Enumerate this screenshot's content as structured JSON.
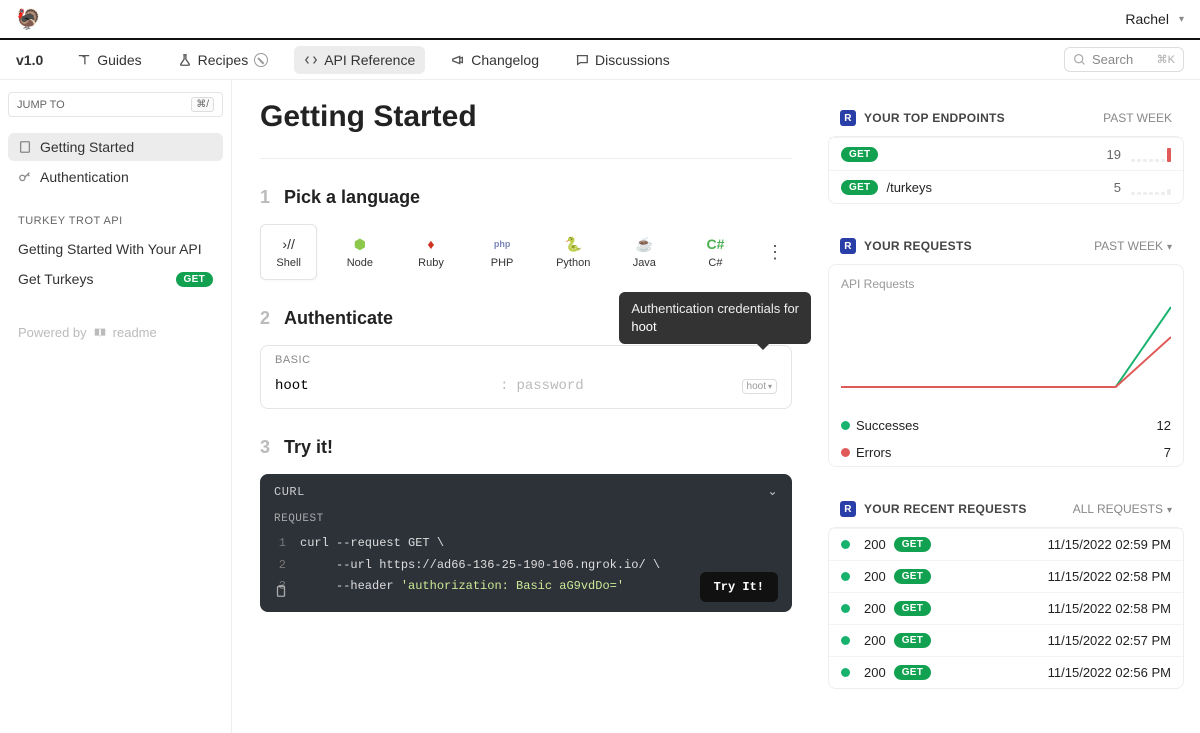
{
  "header": {
    "user_name": "Rachel"
  },
  "nav": {
    "version": "v1.0",
    "guides": "Guides",
    "recipes": "Recipes",
    "api_reference": "API Reference",
    "changelog": "Changelog",
    "discussions": "Discussions",
    "search_placeholder": "Search",
    "search_kbd": "⌘K"
  },
  "sidebar": {
    "jump_to": "JUMP TO",
    "jump_kbd": "⌘/",
    "links": [
      {
        "label": "Getting Started"
      },
      {
        "label": "Authentication"
      }
    ],
    "section_title": "TURKEY TROT API",
    "api_links": [
      {
        "label": "Getting Started With Your API"
      },
      {
        "label": "Get Turkeys",
        "method": "GET"
      }
    ],
    "powered": "Powered by",
    "powered_brand": "readme"
  },
  "content": {
    "title": "Getting Started",
    "step1_label": "Pick a language",
    "step2_label": "Authenticate",
    "step3_label": "Try it!",
    "languages": [
      "Shell",
      "Node",
      "Ruby",
      "PHP",
      "Python",
      "Java",
      "C#"
    ],
    "auth": {
      "type_label": "BASIC",
      "username_value": "hoot",
      "separator": ":",
      "password_placeholder": "password",
      "hint_text": "hoot",
      "tooltip_line1": "Authentication credentials for",
      "tooltip_line2": "hoot"
    },
    "code": {
      "title": "CURL",
      "request_label": "REQUEST",
      "lines": [
        {
          "n": "1",
          "t": "curl --request GET \\"
        },
        {
          "n": "2",
          "t": "     --url https://ad66-136-25-190-106.ngrok.io/ \\"
        },
        {
          "n": "3",
          "t": "     --header 'authorization: Basic aG9vdDo='"
        }
      ],
      "tryit": "Try It!"
    }
  },
  "right": {
    "top_endpoints": {
      "title": "YOUR TOP ENDPOINTS",
      "range": "PAST WEEK",
      "rows": [
        {
          "method": "GET",
          "path": "",
          "count": "19"
        },
        {
          "method": "GET",
          "path": "/turkeys",
          "count": "5"
        }
      ]
    },
    "requests": {
      "title": "YOUR REQUESTS",
      "range": "PAST WEEK",
      "chart_label": "API Requests",
      "success_label": "Successes",
      "success_count": "12",
      "error_label": "Errors",
      "error_count": "7"
    },
    "recent": {
      "title": "YOUR RECENT REQUESTS",
      "range": "ALL REQUESTS",
      "rows": [
        {
          "status": "200",
          "method": "GET",
          "time": "11/15/2022 02:59 PM"
        },
        {
          "status": "200",
          "method": "GET",
          "time": "11/15/2022 02:58 PM"
        },
        {
          "status": "200",
          "method": "GET",
          "time": "11/15/2022 02:58 PM"
        },
        {
          "status": "200",
          "method": "GET",
          "time": "11/15/2022 02:57 PM"
        },
        {
          "status": "200",
          "method": "GET",
          "time": "11/15/2022 02:56 PM"
        }
      ]
    }
  },
  "chart_data": {
    "type": "line",
    "title": "API Requests",
    "x": [
      0,
      1,
      2,
      3,
      4,
      5,
      6
    ],
    "series": [
      {
        "name": "Successes",
        "color": "#17b36e",
        "values": [
          0,
          0,
          0,
          0,
          0,
          0,
          12
        ]
      },
      {
        "name": "Errors",
        "color": "#e05a5a",
        "values": [
          0,
          0,
          0,
          0,
          0,
          0,
          7
        ]
      }
    ],
    "ylim": [
      0,
      12
    ]
  }
}
